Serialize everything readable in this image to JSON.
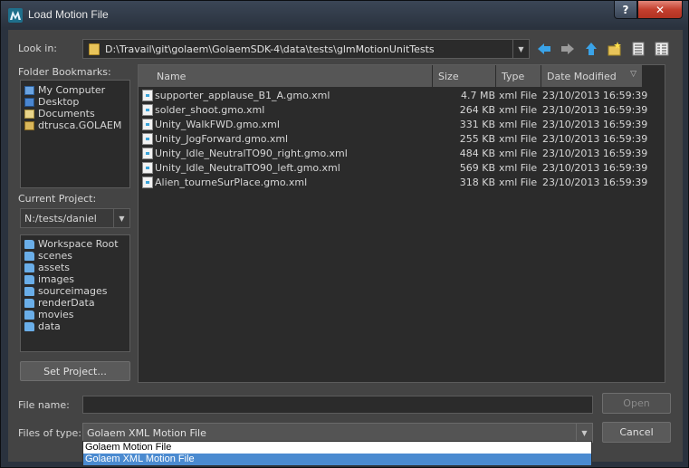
{
  "window": {
    "title": "Load Motion File",
    "help_glyph": "?",
    "close_glyph": "✕"
  },
  "look_in": {
    "label": "Look in:",
    "path": "D:\\Travail\\git\\golaem\\GolaemSDK-4\\data\\tests\\glmMotionUnitTests"
  },
  "folder_bookmarks": {
    "label": "Folder Bookmarks:",
    "items": [
      {
        "label": "My Computer",
        "icon": "computer-icon"
      },
      {
        "label": "Desktop",
        "icon": "desktop-icon"
      },
      {
        "label": "Documents",
        "icon": "documents-icon"
      },
      {
        "label": "dtrusca.GOLAEM",
        "icon": "user-folder-icon"
      }
    ]
  },
  "current_project": {
    "label": "Current Project:",
    "value": "N:/tests/daniel"
  },
  "project_folders": [
    "Workspace Root",
    "scenes",
    "assets",
    "images",
    "sourceimages",
    "renderData",
    "movies",
    "data"
  ],
  "set_project_label": "Set Project...",
  "columns": [
    "Name",
    "Size",
    "Type",
    "Date Modified"
  ],
  "files": [
    {
      "name": "supporter_applause_B1_A.gmo.xml",
      "size": "4.7 MB",
      "type": "xml File",
      "date": "23/10/2013 16:59:39"
    },
    {
      "name": "solder_shoot.gmo.xml",
      "size": "264 KB",
      "type": "xml File",
      "date": "23/10/2013 16:59:39"
    },
    {
      "name": "Unity_WalkFWD.gmo.xml",
      "size": "331 KB",
      "type": "xml File",
      "date": "23/10/2013 16:59:39"
    },
    {
      "name": "Unity_JogForward.gmo.xml",
      "size": "255 KB",
      "type": "xml File",
      "date": "23/10/2013 16:59:39"
    },
    {
      "name": "Unity_Idle_NeutralTO90_right.gmo.xml",
      "size": "484 KB",
      "type": "xml File",
      "date": "23/10/2013 16:59:39"
    },
    {
      "name": "Unity_Idle_NeutralTO90_left.gmo.xml",
      "size": "569 KB",
      "type": "xml File",
      "date": "23/10/2013 16:59:39"
    },
    {
      "name": "Alien_tourneSurPlace.gmo.xml",
      "size": "318 KB",
      "type": "xml File",
      "date": "23/10/2013 16:59:39"
    }
  ],
  "file_name": {
    "label": "File name:",
    "value": ""
  },
  "files_of_type": {
    "label": "Files of type:",
    "value": "Golaem XML Motion File",
    "options": [
      "Golaem Motion File",
      "Golaem XML Motion File"
    ],
    "selected_index": 1
  },
  "buttons": {
    "open": "Open",
    "cancel": "Cancel"
  },
  "colors": {
    "folder_yellow": "#e8c45a",
    "nav_blue": "#3aa3e8",
    "selection_blue": "#4a8ad0"
  }
}
